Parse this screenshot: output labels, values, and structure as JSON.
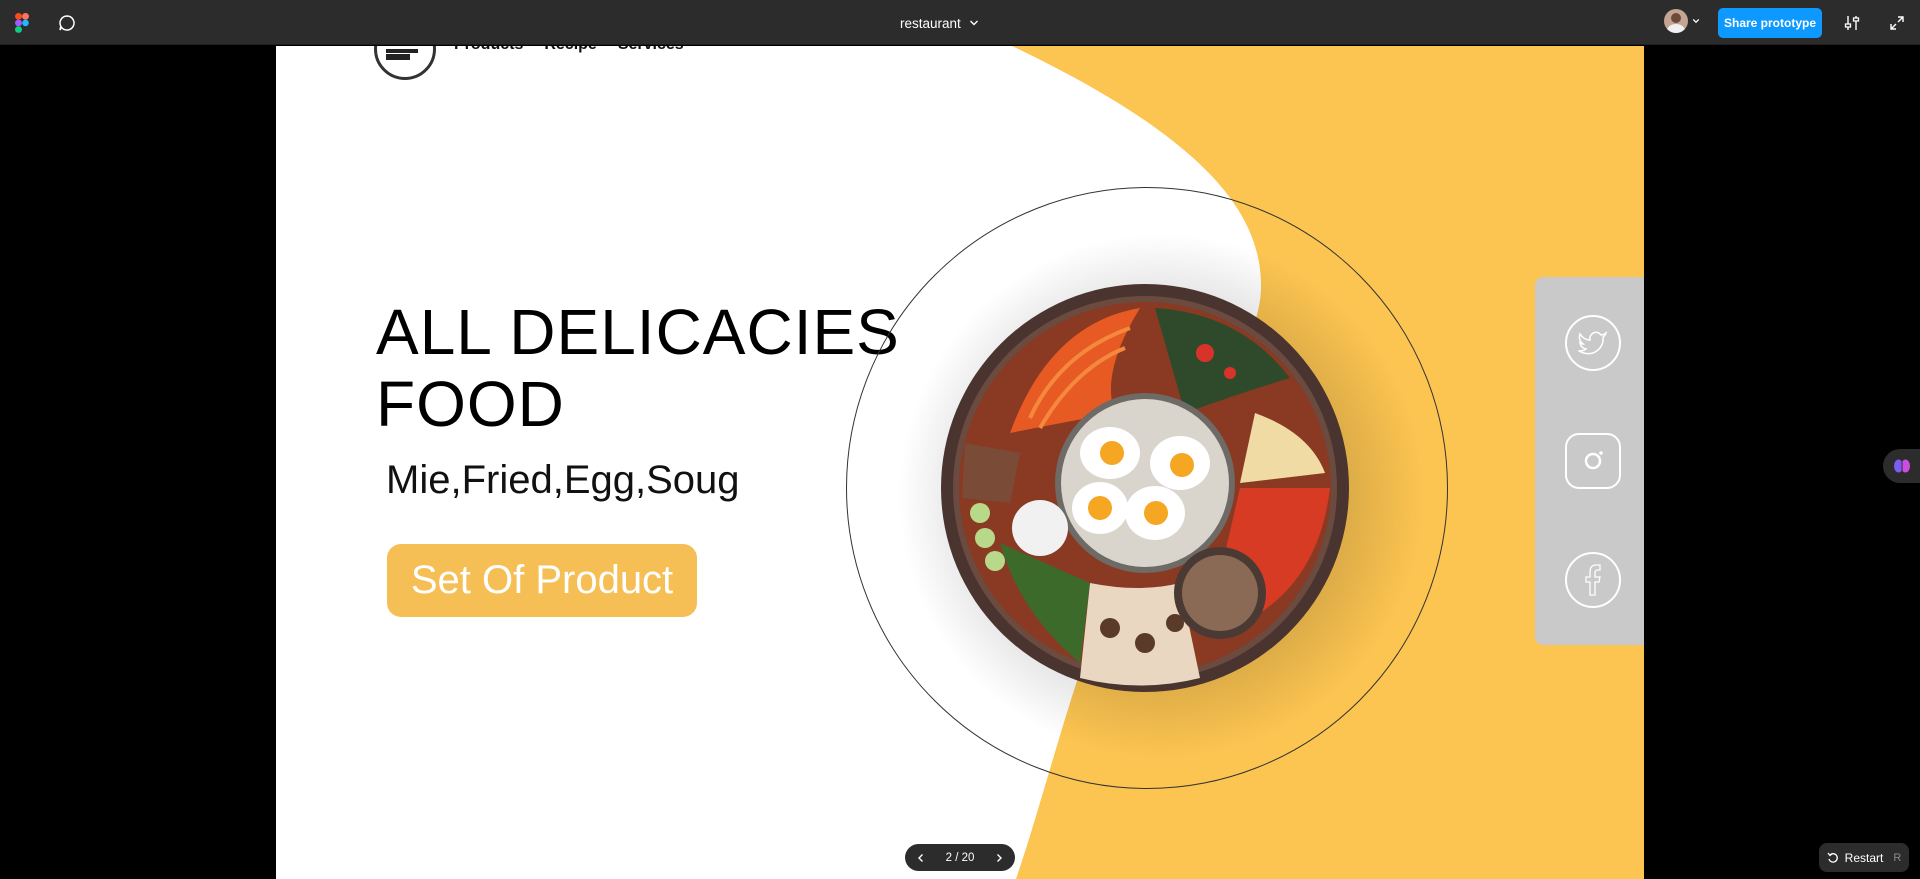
{
  "toolbar": {
    "file_name": "restaurant",
    "share_label": "Share prototype"
  },
  "site": {
    "nav": [
      "Products",
      "Recipe",
      "Services"
    ],
    "headline_line1": "ALL DELICACIES",
    "headline_line2": "FOOD",
    "subline": "Mie,Fried,Egg,Soug",
    "cta_label": "Set Of Product"
  },
  "social": {
    "icons": [
      "twitter-icon",
      "instagram-icon",
      "facebook-icon"
    ]
  },
  "pager": {
    "label": "2 / 20"
  },
  "restart": {
    "label": "Restart",
    "shortcut": "R"
  },
  "colors": {
    "accent_yellow": "#fcc451",
    "button_yellow": "#f6bf55",
    "share_blue": "#0d99ff",
    "toolbar_bg": "#2c2c2c"
  }
}
